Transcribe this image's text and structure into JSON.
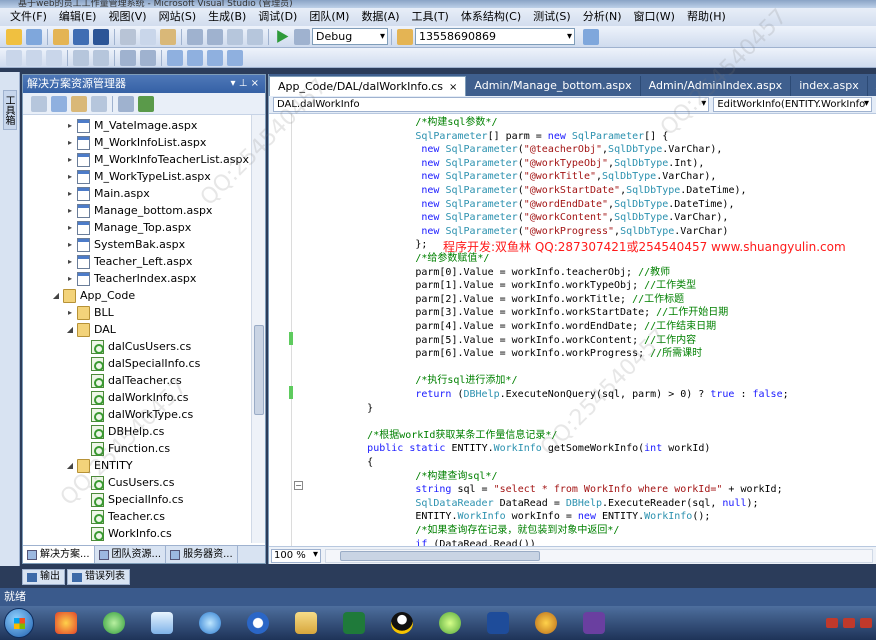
{
  "window": {
    "title": "基于web的员工工作量管理系统 - Microsoft Visual Studio (管理员)"
  },
  "menu": [
    "文件(F)",
    "编辑(E)",
    "视图(V)",
    "网站(S)",
    "生成(B)",
    "调试(D)",
    "团队(M)",
    "数据(A)",
    "工具(T)",
    "体系结构(C)",
    "测试(S)",
    "分析(N)",
    "窗口(W)",
    "帮助(H)"
  ],
  "toolbar": {
    "config": "Debug",
    "find_text": "13558690869"
  },
  "left_strip": {
    "toolbox_label": "工具箱"
  },
  "solution_explorer": {
    "title": "解决方案资源管理器",
    "pin_label": "▾ ⊥ ×",
    "items": [
      {
        "label": "M_VateImage.aspx",
        "kind": "aspx",
        "indent": 2,
        "exp": "▸"
      },
      {
        "label": "M_WorkInfoList.aspx",
        "kind": "aspx",
        "indent": 2,
        "exp": "▸"
      },
      {
        "label": "M_WorkInfoTeacherList.aspx",
        "kind": "aspx",
        "indent": 2,
        "exp": "▸"
      },
      {
        "label": "M_WorkTypeList.aspx",
        "kind": "aspx",
        "indent": 2,
        "exp": "▸"
      },
      {
        "label": "Main.aspx",
        "kind": "aspx",
        "indent": 2,
        "exp": "▸"
      },
      {
        "label": "Manage_bottom.aspx",
        "kind": "aspx",
        "indent": 2,
        "exp": "▸"
      },
      {
        "label": "Manage_Top.aspx",
        "kind": "aspx",
        "indent": 2,
        "exp": "▸"
      },
      {
        "label": "SystemBak.aspx",
        "kind": "aspx",
        "indent": 2,
        "exp": "▸"
      },
      {
        "label": "Teacher_Left.aspx",
        "kind": "aspx",
        "indent": 2,
        "exp": "▸"
      },
      {
        "label": "TeacherIndex.aspx",
        "kind": "aspx",
        "indent": 2,
        "exp": "▸"
      },
      {
        "label": "App_Code",
        "kind": "folder",
        "indent": 1,
        "exp": "◢"
      },
      {
        "label": "BLL",
        "kind": "folder",
        "indent": 2,
        "exp": "▸"
      },
      {
        "label": "DAL",
        "kind": "folder",
        "indent": 2,
        "exp": "◢"
      },
      {
        "label": "dalCusUsers.cs",
        "kind": "cs",
        "indent": 3,
        "exp": ""
      },
      {
        "label": "dalSpecialInfo.cs",
        "kind": "cs",
        "indent": 3,
        "exp": ""
      },
      {
        "label": "dalTeacher.cs",
        "kind": "cs",
        "indent": 3,
        "exp": ""
      },
      {
        "label": "dalWorkInfo.cs",
        "kind": "cs",
        "indent": 3,
        "exp": ""
      },
      {
        "label": "dalWorkType.cs",
        "kind": "cs",
        "indent": 3,
        "exp": ""
      },
      {
        "label": "DBHelp.cs",
        "kind": "cs",
        "indent": 3,
        "exp": ""
      },
      {
        "label": "Function.cs",
        "kind": "cs",
        "indent": 3,
        "exp": ""
      },
      {
        "label": "ENTITY",
        "kind": "folder",
        "indent": 2,
        "exp": "◢"
      },
      {
        "label": "CusUsers.cs",
        "kind": "cs",
        "indent": 3,
        "exp": ""
      },
      {
        "label": "SpecialInfo.cs",
        "kind": "cs",
        "indent": 3,
        "exp": ""
      },
      {
        "label": "Teacher.cs",
        "kind": "cs",
        "indent": 3,
        "exp": ""
      },
      {
        "label": "WorkInfo.cs",
        "kind": "cs",
        "indent": 3,
        "exp": ""
      }
    ],
    "tabs": [
      "解决方案...",
      "团队资源...",
      "服务器资..."
    ]
  },
  "editor": {
    "tabs": [
      {
        "label": "App_Code/DAL/dalWorkInfo.cs",
        "active": true
      },
      {
        "label": "Admin/Manage_bottom.aspx",
        "active": false
      },
      {
        "label": "Admin/AdminIndex.aspx",
        "active": false
      },
      {
        "label": "index.aspx",
        "active": false
      },
      {
        "label": "App_",
        "active": false
      }
    ],
    "class_combo": "DAL.dalWorkInfo",
    "member_combo": "EditWorkInfo(ENTITY.WorkInfo",
    "zoom": "100 %",
    "overlay_text": "程序开发:双鱼林 QQ:287307421或254540457 www.shuangyulin.com",
    "lines": [
      {
        "indent": 6,
        "html": "<span class='cm'>/*构建sql参数*/</span>"
      },
      {
        "indent": 6,
        "html": "<span class='ty'>SqlParameter</span>[] parm = <span class='kw'>new</span> <span class='ty'>SqlParameter</span>[] {"
      },
      {
        "indent": 6,
        "html": " <span class='kw'>new</span> <span class='ty'>SqlParameter</span>(<span class='st'>\"@teacherObj\"</span>,<span class='ty'>SqlDbType</span>.VarChar),"
      },
      {
        "indent": 6,
        "html": " <span class='kw'>new</span> <span class='ty'>SqlParameter</span>(<span class='st'>\"@workTypeObj\"</span>,<span class='ty'>SqlDbType</span>.Int),"
      },
      {
        "indent": 6,
        "html": " <span class='kw'>new</span> <span class='ty'>SqlParameter</span>(<span class='st'>\"@workTitle\"</span>,<span class='ty'>SqlDbType</span>.VarChar),"
      },
      {
        "indent": 6,
        "html": " <span class='kw'>new</span> <span class='ty'>SqlParameter</span>(<span class='st'>\"@workStartDate\"</span>,<span class='ty'>SqlDbType</span>.DateTime),"
      },
      {
        "indent": 6,
        "html": " <span class='kw'>new</span> <span class='ty'>SqlParameter</span>(<span class='st'>\"@wordEndDate\"</span>,<span class='ty'>SqlDbType</span>.DateTime),"
      },
      {
        "indent": 6,
        "html": " <span class='kw'>new</span> <span class='ty'>SqlParameter</span>(<span class='st'>\"@workContent\"</span>,<span class='ty'>SqlDbType</span>.VarChar),"
      },
      {
        "indent": 6,
        "html": " <span class='kw'>new</span> <span class='ty'>SqlParameter</span>(<span class='st'>\"@workProgress\"</span>,<span class='ty'>SqlDbType</span>.VarChar)"
      },
      {
        "indent": 6,
        "html": "};"
      },
      {
        "indent": 6,
        "html": "<span class='cm'>/*给参数赋值*/</span>"
      },
      {
        "indent": 6,
        "html": "parm[0].Value = workInfo.teacherObj; <span class='cm'>//教师</span>"
      },
      {
        "indent": 6,
        "html": "parm[1].Value = workInfo.workTypeObj; <span class='cm'>//工作类型</span>"
      },
      {
        "indent": 6,
        "html": "parm[2].Value = workInfo.workTitle; <span class='cm'>//工作标题</span>"
      },
      {
        "indent": 6,
        "html": "parm[3].Value = workInfo.workStartDate; <span class='cm'>//工作开始日期</span>"
      },
      {
        "indent": 6,
        "html": "parm[4].Value = workInfo.wordEndDate; <span class='cm'>//工作结束日期</span>"
      },
      {
        "indent": 6,
        "html": "parm[5].Value = workInfo.workContent; <span class='cm'>//工作内容</span>"
      },
      {
        "indent": 6,
        "html": "parm[6].Value = workInfo.workProgress; <span class='cm'>//所需课时</span>"
      },
      {
        "indent": 0,
        "html": ""
      },
      {
        "indent": 6,
        "html": "<span class='cm'>/*执行sql进行添加*/</span>"
      },
      {
        "indent": 6,
        "html": "<span class='kw'>return</span> (<span class='ty'>DBHelp</span>.ExecuteNonQuery(sql, parm) &gt; 0) ? <span class='kw'>true</span> : <span class='kw'>false</span>;"
      },
      {
        "indent": 4,
        "html": "}"
      },
      {
        "indent": 0,
        "html": ""
      },
      {
        "indent": 4,
        "html": "<span class='cm'>/*根据workId获取某条工作量信息记录*/</span>"
      },
      {
        "indent": 4,
        "html": "<span class='kw'>public</span> <span class='kw'>static</span> ENTITY.<span class='ty'>WorkInfo</span> getSomeWorkInfo(<span class='kw'>int</span> workId)"
      },
      {
        "indent": 4,
        "html": "{"
      },
      {
        "indent": 6,
        "html": "<span class='cm'>/*构建查询sql*/</span>"
      },
      {
        "indent": 6,
        "html": "<span class='kw'>string</span> sql = <span class='st'>\"select * from WorkInfo where workId=\"</span> + workId;"
      },
      {
        "indent": 6,
        "html": "<span class='ty'>SqlDataReader</span> DataRead = <span class='ty'>DBHelp</span>.ExecuteReader(sql, <span class='kw'>null</span>);"
      },
      {
        "indent": 6,
        "html": "ENTITY.<span class='ty'>WorkInfo</span> workInfo = <span class='kw'>new</span> ENTITY.<span class='ty'>WorkInfo</span>();"
      },
      {
        "indent": 6,
        "html": "<span class='cm'>/*如果查询存在记录，就包装到对象中返回*/</span>"
      },
      {
        "indent": 6,
        "html": "<span class='kw'>if</span> (DataRead.Read())"
      }
    ]
  },
  "bottom_panel_tabs": [
    "输出",
    "错误列表"
  ],
  "status": {
    "text": "就绪"
  }
}
